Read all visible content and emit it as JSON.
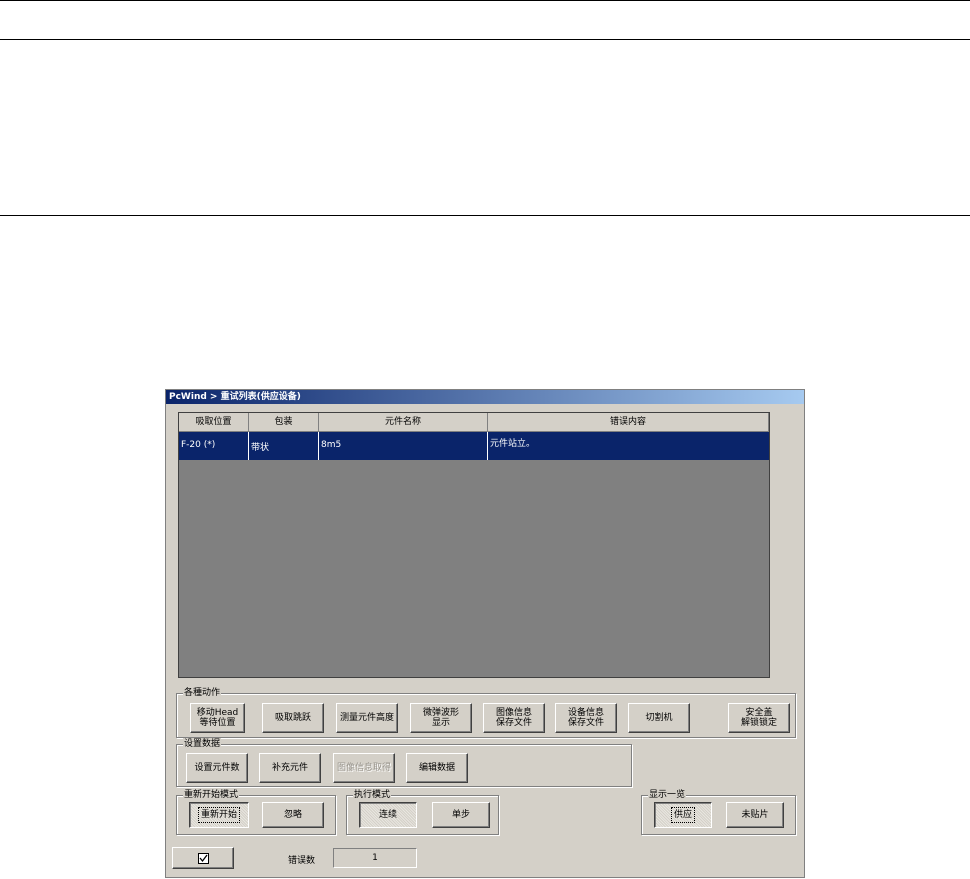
{
  "window": {
    "title": "PcWind > 重试列表(供应设备)"
  },
  "grid": {
    "columns": [
      "吸取位置",
      "包装",
      "元件名称",
      "错误内容"
    ],
    "rows": [
      [
        "F-20 (*)",
        "带状",
        "8m5",
        "元件站立。"
      ]
    ]
  },
  "groups": {
    "actions": {
      "label": "各種动作",
      "buttons": [
        "移动Head\n等待位置",
        "吸取跳跃",
        "测量元件高度",
        "微弹波形\n显示",
        "图像信息\n保存文件",
        "设备信息\n保存文件",
        "切割机",
        "安全盖\n解锁锁定"
      ]
    },
    "setup": {
      "label": "设置数据",
      "buttons": [
        "设置元件数",
        "补充元件",
        "图像信息取得",
        "编辑数据"
      ]
    },
    "restart": {
      "label": "重新开始模式",
      "buttons": [
        "重新开始",
        "忽略"
      ]
    },
    "exec": {
      "label": "执行模式",
      "buttons": [
        "连续",
        "单步"
      ]
    },
    "display": {
      "label": "显示一览",
      "buttons": [
        "供应",
        "未贴片"
      ]
    }
  },
  "footer": {
    "icon": "checkbox-icon",
    "error_count_label": "错误数",
    "error_count_value": "1"
  }
}
